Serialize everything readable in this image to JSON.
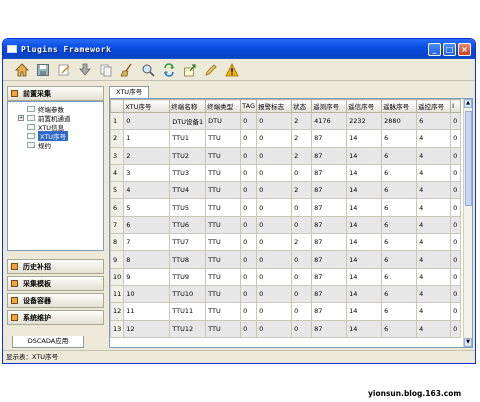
{
  "window": {
    "title": "Plugins Framework"
  },
  "window_buttons": {
    "minimize": "_",
    "maximize": "□",
    "close": "×"
  },
  "toolbar": {
    "icons": [
      "home-icon",
      "save-icon",
      "edit-icon",
      "download-icon",
      "copy-icon",
      "broom-icon",
      "search-icon",
      "refresh-icon",
      "export-icon",
      "pencil-icon",
      "warning-icon"
    ]
  },
  "sidebar": {
    "group_top": "前置采集",
    "tree": [
      {
        "label": "终端参数",
        "level": 1,
        "expander": ""
      },
      {
        "label": "前置机通道",
        "level": 1,
        "expander": "+"
      },
      {
        "label": "XTU信息",
        "level": 1,
        "expander": ""
      },
      {
        "label": "XTU序号",
        "level": 1,
        "expander": "",
        "selected": true
      },
      {
        "label": "规约",
        "level": 1,
        "expander": ""
      }
    ],
    "groups": [
      "历史补招",
      "采集模板",
      "设备容器",
      "系统维护"
    ],
    "bottom_tab": "DSCADA应用"
  },
  "content": {
    "tab_label": "XTU序号",
    "columns": [
      "",
      "XTU序号",
      "终端名称",
      "终端类型",
      "TAG",
      "报警标志",
      "状态",
      "遥测序号",
      "遥信序号",
      "遥脉序号",
      "遥控序号",
      "I"
    ],
    "rows": [
      [
        "1",
        "0",
        "DTU设备1",
        "DTU",
        "0",
        "0",
        "2",
        "4176",
        "2232",
        "2880",
        "6",
        "0"
      ],
      [
        "2",
        "1",
        "TTU1",
        "TTU",
        "0",
        "0",
        "2",
        "87",
        "14",
        "6",
        "4",
        "0"
      ],
      [
        "3",
        "2",
        "TTU2",
        "TTU",
        "0",
        "0",
        "2",
        "87",
        "14",
        "6",
        "4",
        "0"
      ],
      [
        "4",
        "3",
        "TTU3",
        "TTU",
        "0",
        "0",
        "0",
        "87",
        "14",
        "6",
        "4",
        "0"
      ],
      [
        "5",
        "4",
        "TTU4",
        "TTU",
        "0",
        "0",
        "2",
        "87",
        "14",
        "6",
        "4",
        "0"
      ],
      [
        "6",
        "5",
        "TTU5",
        "TTU",
        "0",
        "0",
        "0",
        "87",
        "14",
        "6",
        "4",
        "0"
      ],
      [
        "7",
        "6",
        "TTU6",
        "TTU",
        "0",
        "0",
        "0",
        "87",
        "14",
        "6",
        "4",
        "0"
      ],
      [
        "8",
        "7",
        "TTU7",
        "TTU",
        "0",
        "0",
        "2",
        "87",
        "14",
        "6",
        "4",
        "0"
      ],
      [
        "9",
        "8",
        "TTU8",
        "TTU",
        "0",
        "0",
        "0",
        "87",
        "14",
        "6",
        "4",
        "0"
      ],
      [
        "10",
        "9",
        "TTU9",
        "TTU",
        "0",
        "0",
        "0",
        "87",
        "14",
        "6",
        "4",
        "0"
      ],
      [
        "11",
        "10",
        "TTU10",
        "TTU",
        "0",
        "0",
        "0",
        "87",
        "14",
        "6",
        "4",
        "0"
      ],
      [
        "12",
        "11",
        "TTU11",
        "TTU",
        "0",
        "0",
        "0",
        "87",
        "14",
        "6",
        "4",
        "0"
      ],
      [
        "13",
        "12",
        "TTU12",
        "TTU",
        "0",
        "0",
        "0",
        "87",
        "14",
        "6",
        "4",
        "0"
      ]
    ]
  },
  "status": {
    "text": "显示表：XTU序号"
  },
  "watermark": "yionsun.blog.163.com",
  "colors": {
    "titlebar": "#0a4ee3",
    "selection": "#316ac5",
    "window_bg": "#ece9d8"
  }
}
